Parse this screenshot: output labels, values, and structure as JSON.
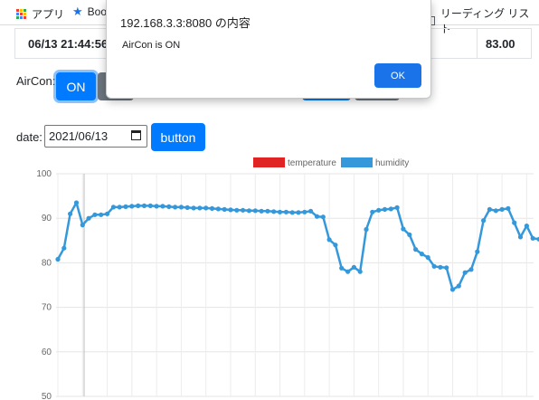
{
  "bookmarks": {
    "apps_label": "アプリ",
    "bookmarks_label": "Book",
    "reading_list_label": "リーディング リスト"
  },
  "table": {
    "time": "06/13 21:44:56",
    "value": "83.00"
  },
  "aircon": {
    "label": "AirCon:",
    "on_label": "ON"
  },
  "date": {
    "label": "date:",
    "value": "2021/06/13",
    "button_label": "button"
  },
  "dialog": {
    "title": "192.168.3.3:8080 の内容",
    "message": "AirCon is ON",
    "ok_label": "OK"
  },
  "colors": {
    "temperature": "#e02424",
    "humidity": "#3498db",
    "primary_button": "#007bff",
    "secondary_button": "#6c757d"
  },
  "chart_data": {
    "type": "line",
    "series": [
      {
        "name": "temperature",
        "color": "#e02424",
        "values": []
      },
      {
        "name": "humidity",
        "color": "#3498db",
        "values": [
          80.8,
          83.3,
          91.0,
          93.5,
          88.5,
          90.0,
          90.8,
          90.8,
          91.0,
          92.5,
          92.5,
          92.6,
          92.7,
          92.8,
          92.8,
          92.8,
          92.7,
          92.7,
          92.6,
          92.5,
          92.5,
          92.4,
          92.3,
          92.3,
          92.3,
          92.2,
          92.1,
          92.0,
          91.9,
          91.8,
          91.8,
          91.7,
          91.7,
          91.6,
          91.6,
          91.5,
          91.4,
          91.4,
          91.3,
          91.3,
          91.4,
          91.6,
          90.4,
          90.3,
          85.2,
          84.0,
          78.8,
          78.0,
          79.0,
          78.0,
          87.5,
          91.4,
          91.8,
          92.0,
          92.1,
          92.4,
          87.6,
          86.3,
          83.0,
          82.0,
          81.2,
          79.2,
          79.0,
          78.9,
          74.0,
          74.8,
          77.8,
          78.5,
          82.5,
          89.5,
          92.0,
          91.7,
          92.0,
          92.2,
          89.0,
          85.8,
          88.3,
          85.5,
          85.3
        ]
      }
    ],
    "legend": [
      "temperature",
      "humidity"
    ],
    "legend_position": "top-center",
    "y_ticks": [
      100,
      90,
      80,
      70,
      60,
      50
    ],
    "ylim": [
      50,
      100
    ],
    "grid": true
  }
}
